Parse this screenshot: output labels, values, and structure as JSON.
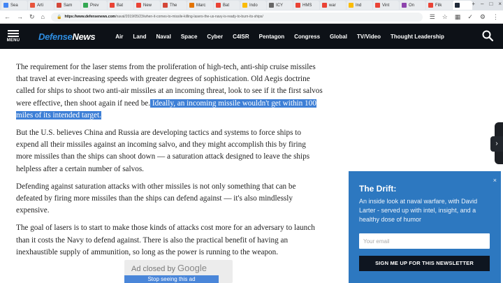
{
  "browser": {
    "tabs": [
      {
        "label": "Sea",
        "color": "#4285f4",
        "active": false
      },
      {
        "label": "Arti",
        "color": "#e8543c",
        "active": false
      },
      {
        "label": "Sam",
        "color": "#d44638",
        "active": false
      },
      {
        "label": "Prev",
        "color": "#34a853",
        "active": false
      },
      {
        "label": "Bat",
        "color": "#ea4335",
        "active": false
      },
      {
        "label": "New",
        "color": "#ea4335",
        "active": false
      },
      {
        "label": "The",
        "color": "#d44638",
        "active": false
      },
      {
        "label": "Marc",
        "color": "#e37400",
        "active": false
      },
      {
        "label": "Bat",
        "color": "#ea4335",
        "active": false
      },
      {
        "label": "Indo",
        "color": "#fbbc05",
        "active": false
      },
      {
        "label": "ICY",
        "color": "#666666",
        "active": false
      },
      {
        "label": "HMS",
        "color": "#ea4335",
        "active": false
      },
      {
        "label": "war",
        "color": "#ea4335",
        "active": false
      },
      {
        "label": "Ind",
        "color": "#fbbc05",
        "active": false
      },
      {
        "label": "Vint",
        "color": "#ea4335",
        "active": false
      },
      {
        "label": "On",
        "color": "#8e44ad",
        "active": false
      },
      {
        "label": "Filk",
        "color": "#ea4335",
        "active": false
      },
      {
        "label": "",
        "color": "#1f2a38",
        "active": true
      }
    ],
    "url_host": "https://www.defensenews.com",
    "url_path": "/naval/2019/05/23/when-it-comes-to-missile-killing-lasers-the-us-navy-is-ready-to-burn-its-ships/"
  },
  "site": {
    "menu_label": "MENU",
    "logo_part1": "Defense",
    "logo_part2": "News",
    "nav_items": [
      "Air",
      "Land",
      "Naval",
      "Space",
      "Cyber",
      "C4ISR",
      "Pentagon",
      "Congress",
      "Global",
      "TV/Video",
      "Thought Leadership"
    ]
  },
  "article": {
    "p1_a": "The requirement for the laser stems from the proliferation of high-tech, anti-ship cruise missiles that travel at ever-increasing speeds with greater degrees of sophistication. Old Aegis doctrine called for ships to shoot two anti-air missiles at an incoming threat, look to see if it the first salvos were effective, then shoot again if need be.",
    "p1_highlight": " Ideally, an incoming missile wouldn't get within 100 miles of its intended target.",
    "p2": "But the U.S. believes China and Russia are developing tactics and systems to force ships to expend all their missiles against an incoming salvo, and they might accomplish this by firing more missiles than the ships can shoot down — a saturation attack designed to leave the ships helpless after a certain number of salvos.",
    "p3": "Defending against saturation attacks with other missiles is not only something that can be defeated by firing more missiles than the ships can defend against — it's also mindlessly expensive.",
    "p4": "The goal of lasers is to start to make those kinds of attacks cost more for an adversary to launch than it costs the Navy to defend against. There is also the practical benefit of having an inexhaustible supply of ammunition, so long as the power is running to the weapon."
  },
  "ad": {
    "closed_text": "Ad closed by",
    "google": "Google",
    "button": "Stop seeing this ad"
  },
  "newsletter": {
    "title": "The Drift:",
    "description": "An inside look at naval warfare, with David Larter - served up with intel, insight, and a healthy dose of humor",
    "email_placeholder": "Your email",
    "signup_button": "SIGN ME UP FOR THIS NEWSLETTER",
    "close": "×"
  },
  "colors": {
    "nav_bg": "#0d1117",
    "logo_blue": "#2e8de0",
    "highlight": "#3d7fd6",
    "newsletter_bg": "#2d78c0"
  }
}
